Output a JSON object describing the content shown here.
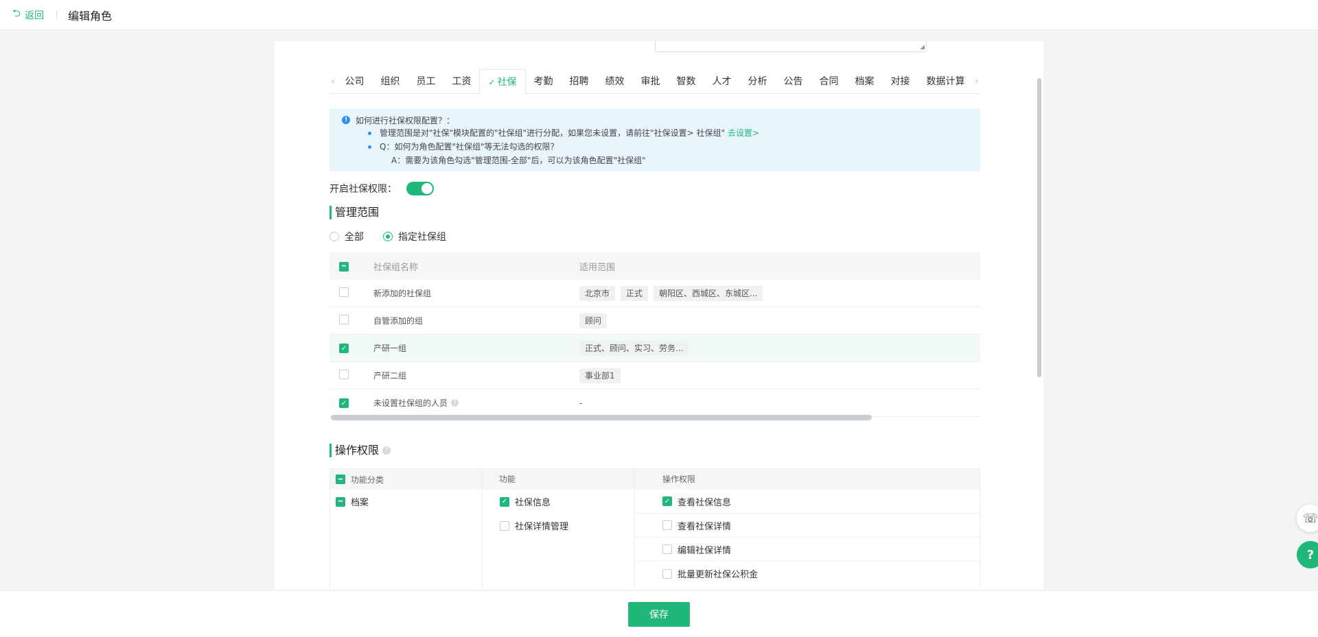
{
  "header": {
    "back_label": "返回",
    "title": "编辑角色"
  },
  "tabs": {
    "items": [
      "公司",
      "组织",
      "员工",
      "工资",
      "社保",
      "考勤",
      "招聘",
      "绩效",
      "审批",
      "智数",
      "人才",
      "分析",
      "公告",
      "合同",
      "档案",
      "对接",
      "数据计算"
    ],
    "active": "社保"
  },
  "notice": {
    "title": "如何进行社保权限配置？：",
    "line1": "管理范围是对\"社保\"模块配置的\"社保组\"进行分配，如果您未设置，请前往\"社保设置> 社保组\"",
    "line1_link": "去设置>",
    "line2": "Q：如何为角色配置\"社保组\"等无法勾选的权限？",
    "line3": "A：需要为该角色勾选\"管理范围-全部\"后，可以为该角色配置\"社保组\""
  },
  "permission_switch": {
    "label": "开启社保权限：",
    "on": true
  },
  "scope": {
    "title": "管理范围",
    "options": [
      "全部",
      "指定社保组"
    ],
    "selected": "指定社保组"
  },
  "group_table": {
    "columns": [
      "社保组名称",
      "适用范围"
    ],
    "rows": [
      {
        "name": "新添加的社保组",
        "checked": false,
        "tags": [
          "北京市",
          "正式",
          "朝阳区、西城区、东城区..."
        ]
      },
      {
        "name": "自管添加的组",
        "checked": false,
        "tags": [
          "顾问"
        ]
      },
      {
        "name": "产研一组",
        "checked": true,
        "tags": [
          "正式、顾问、实习、劳务..."
        ]
      },
      {
        "name": "产研二组",
        "checked": false,
        "tags": [
          "事业部1"
        ]
      },
      {
        "name": "未设置社保组的人员",
        "checked": true,
        "tags": [],
        "empty": "-"
      }
    ]
  },
  "operations": {
    "title": "操作权限",
    "columns": [
      "功能分类",
      "功能",
      "操作权限"
    ],
    "category": "档案",
    "functions": [
      {
        "label": "社保信息",
        "checked": true
      },
      {
        "label": "社保详情管理",
        "checked": false
      }
    ],
    "permissions": [
      {
        "label": "查看社保信息",
        "checked": true
      },
      {
        "label": "查看社保详情",
        "checked": false
      },
      {
        "label": "编辑社保详情",
        "checked": false
      },
      {
        "label": "批量更新社保公积金",
        "checked": false
      }
    ]
  },
  "footer": {
    "save_label": "保存"
  },
  "colors": {
    "accent": "#1fb77a",
    "info": "#2b8ff0",
    "notice_bg": "#e9f5fd"
  }
}
